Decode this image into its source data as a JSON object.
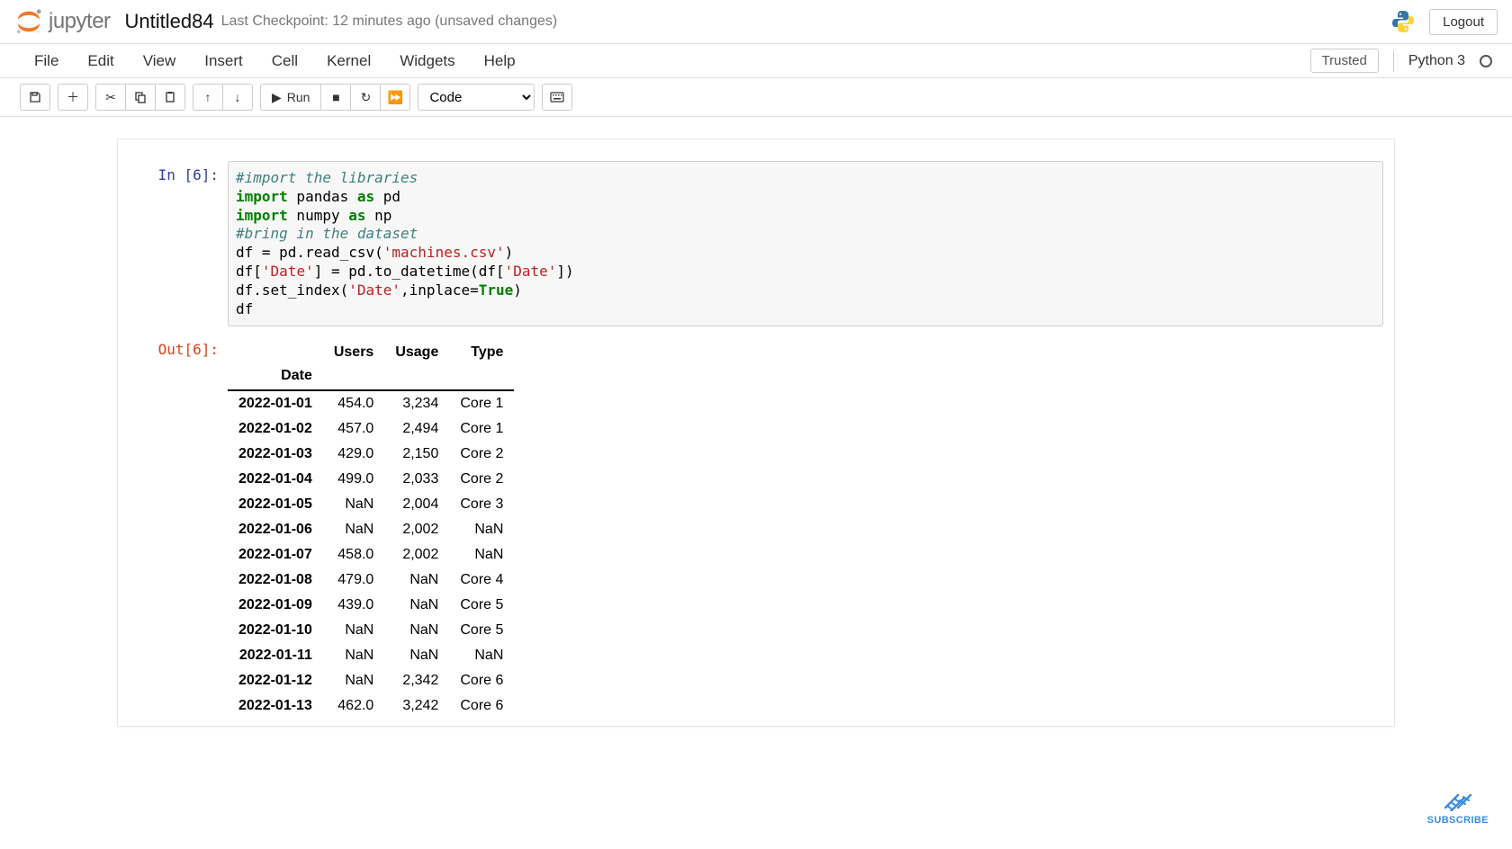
{
  "header": {
    "logo_text": "jupyter",
    "notebook_name": "Untitled84",
    "checkpoint": "Last Checkpoint: 12 minutes ago  (unsaved changes)",
    "logout": "Logout"
  },
  "menu": {
    "items": [
      "File",
      "Edit",
      "View",
      "Insert",
      "Cell",
      "Kernel",
      "Widgets",
      "Help"
    ],
    "trusted": "Trusted",
    "kernel_name": "Python 3"
  },
  "toolbar": {
    "run_label": "Run",
    "cell_type": "Code"
  },
  "cell": {
    "in_label": "In [6]:",
    "out_label": "Out[6]:",
    "code": {
      "l1": "#import the libraries",
      "l2a": "import",
      "l2b": " pandas ",
      "l2c": "as",
      "l2d": " pd",
      "l3a": "import",
      "l3b": " numpy ",
      "l3c": "as",
      "l3d": " np",
      "l4": "#bring in the dataset",
      "l5a": "df = pd.read_csv(",
      "l5b": "'machines.csv'",
      "l5c": ")",
      "l6a": "df[",
      "l6b": "'Date'",
      "l6c": "] = pd.to_datetime(df[",
      "l6d": "'Date'",
      "l6e": "])",
      "l7a": "df.set_index(",
      "l7b": "'Date'",
      "l7c": ",inplace=",
      "l7d": "True",
      "l7e": ")",
      "l8": "df"
    }
  },
  "output": {
    "columns": [
      "",
      "Users",
      "Usage",
      "Type"
    ],
    "index_name": "Date",
    "rows": [
      {
        "date": "2022-01-01",
        "users": "454.0",
        "usage": "3,234",
        "type": "Core 1"
      },
      {
        "date": "2022-01-02",
        "users": "457.0",
        "usage": "2,494",
        "type": "Core 1"
      },
      {
        "date": "2022-01-03",
        "users": "429.0",
        "usage": "2,150",
        "type": "Core 2"
      },
      {
        "date": "2022-01-04",
        "users": "499.0",
        "usage": "2,033",
        "type": "Core 2"
      },
      {
        "date": "2022-01-05",
        "users": "NaN",
        "usage": "2,004",
        "type": "Core 3"
      },
      {
        "date": "2022-01-06",
        "users": "NaN",
        "usage": "2,002",
        "type": "NaN"
      },
      {
        "date": "2022-01-07",
        "users": "458.0",
        "usage": "2,002",
        "type": "NaN"
      },
      {
        "date": "2022-01-08",
        "users": "479.0",
        "usage": "NaN",
        "type": "Core 4"
      },
      {
        "date": "2022-01-09",
        "users": "439.0",
        "usage": "NaN",
        "type": "Core 5"
      },
      {
        "date": "2022-01-10",
        "users": "NaN",
        "usage": "NaN",
        "type": "Core 5"
      },
      {
        "date": "2022-01-11",
        "users": "NaN",
        "usage": "NaN",
        "type": "NaN"
      },
      {
        "date": "2022-01-12",
        "users": "NaN",
        "usage": "2,342",
        "type": "Core 6"
      },
      {
        "date": "2022-01-13",
        "users": "462.0",
        "usage": "3,242",
        "type": "Core 6"
      }
    ]
  },
  "subscribe": {
    "label": "SUBSCRIBE"
  },
  "chart_data": {
    "type": "table",
    "title": "DataFrame output",
    "index_name": "Date",
    "columns": [
      "Users",
      "Usage",
      "Type"
    ],
    "rows": [
      {
        "Date": "2022-01-01",
        "Users": 454.0,
        "Usage": 3234,
        "Type": "Core 1"
      },
      {
        "Date": "2022-01-02",
        "Users": 457.0,
        "Usage": 2494,
        "Type": "Core 1"
      },
      {
        "Date": "2022-01-03",
        "Users": 429.0,
        "Usage": 2150,
        "Type": "Core 2"
      },
      {
        "Date": "2022-01-04",
        "Users": 499.0,
        "Usage": 2033,
        "Type": "Core 2"
      },
      {
        "Date": "2022-01-05",
        "Users": null,
        "Usage": 2004,
        "Type": "Core 3"
      },
      {
        "Date": "2022-01-06",
        "Users": null,
        "Usage": 2002,
        "Type": null
      },
      {
        "Date": "2022-01-07",
        "Users": 458.0,
        "Usage": 2002,
        "Type": null
      },
      {
        "Date": "2022-01-08",
        "Users": 479.0,
        "Usage": null,
        "Type": "Core 4"
      },
      {
        "Date": "2022-01-09",
        "Users": 439.0,
        "Usage": null,
        "Type": "Core 5"
      },
      {
        "Date": "2022-01-10",
        "Users": null,
        "Usage": null,
        "Type": "Core 5"
      },
      {
        "Date": "2022-01-11",
        "Users": null,
        "Usage": null,
        "Type": null
      },
      {
        "Date": "2022-01-12",
        "Users": null,
        "Usage": 2342,
        "Type": "Core 6"
      },
      {
        "Date": "2022-01-13",
        "Users": 462.0,
        "Usage": 3242,
        "Type": "Core 6"
      }
    ]
  }
}
